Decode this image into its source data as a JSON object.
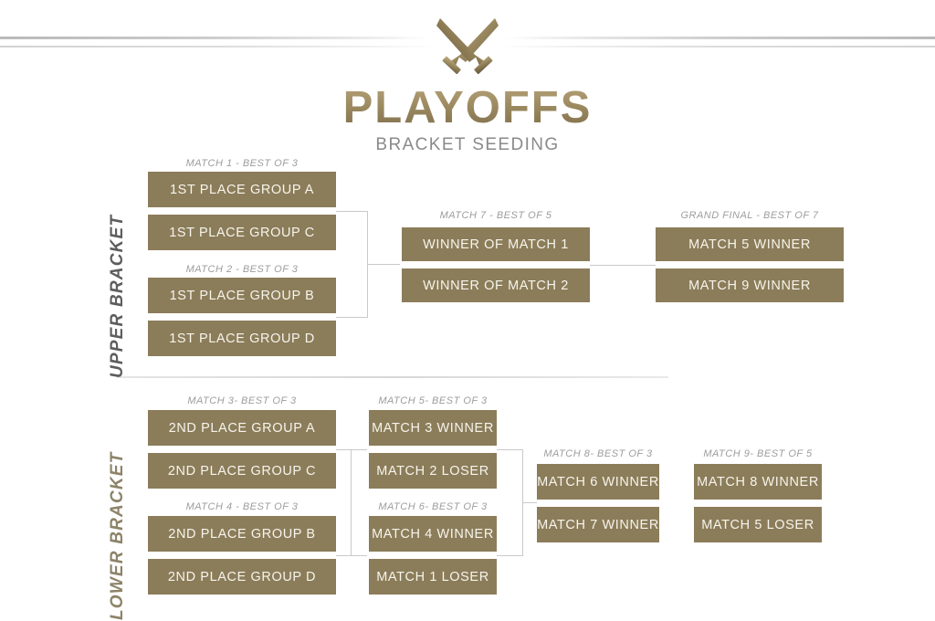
{
  "header": {
    "logo_icon": "crossed-swords-icon",
    "title": "PLAYOFFS",
    "subtitle": "BRACKET SEEDING",
    "title_color": "#9b8a61",
    "subtitle_color": "#8a8a8a"
  },
  "theme": {
    "slot_fill": "#8b7d5a",
    "slot_text": "#f7f4ec",
    "label_text": "#9d9d9d",
    "connector": "#c9c9c9",
    "upper_label_color": "#5d5d5d",
    "lower_label_color": "#8c8368"
  },
  "sections": {
    "upper": {
      "label": "UPPER BRACKET"
    },
    "lower": {
      "label": "LOWER BRACKET"
    }
  },
  "matches": [
    {
      "id": "match-1",
      "label": "MATCH 1 - BEST OF 3",
      "slots": [
        "1ST PLACE GROUP A",
        "1ST PLACE GROUP C"
      ]
    },
    {
      "id": "match-2",
      "label": "MATCH 2 - BEST OF 3",
      "slots": [
        "1ST PLACE GROUP B",
        "1ST PLACE GROUP D"
      ]
    },
    {
      "id": "match-7",
      "label": "MATCH 7 - BEST OF 5",
      "slots": [
        "WINNER OF MATCH 1",
        "WINNER OF MATCH 2"
      ]
    },
    {
      "id": "grand-final",
      "label": "GRAND FINAL - BEST OF 7",
      "slots": [
        "MATCH 5 WINNER",
        "MATCH 9 WINNER"
      ]
    },
    {
      "id": "match-3",
      "label": "MATCH 3- BEST OF 3",
      "slots": [
        "2ND PLACE GROUP A",
        "2ND PLACE GROUP C"
      ]
    },
    {
      "id": "match-4",
      "label": "MATCH 4 - BEST OF 3",
      "slots": [
        "2ND PLACE GROUP B",
        "2ND PLACE GROUP D"
      ]
    },
    {
      "id": "match-5",
      "label": "MATCH 5- BEST OF 3",
      "slots": [
        "MATCH 3 WINNER",
        "MATCH 2 LOSER"
      ]
    },
    {
      "id": "match-6",
      "label": "MATCH 6- BEST OF 3",
      "slots": [
        "MATCH 4 WINNER",
        "MATCH 1 LOSER"
      ]
    },
    {
      "id": "match-8",
      "label": "MATCH 8- BEST OF 3",
      "slots": [
        "MATCH 6 WINNER",
        "MATCH 7 WINNER"
      ]
    },
    {
      "id": "match-9",
      "label": "MATCH 9- BEST OF 5",
      "slots": [
        "MATCH 8 WINNER",
        "MATCH 5 LOSER"
      ]
    }
  ]
}
